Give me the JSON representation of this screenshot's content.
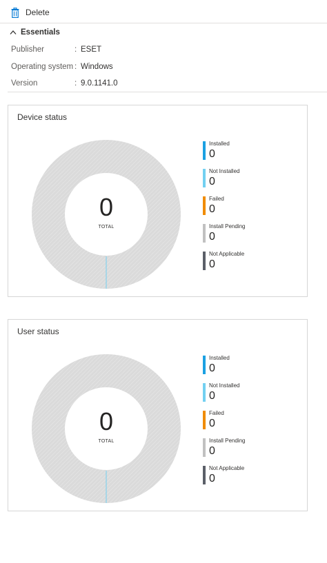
{
  "toolbar": {
    "delete_label": "Delete"
  },
  "essentials": {
    "header": "Essentials",
    "props": [
      {
        "key": "Publisher",
        "sep": ":",
        "value": "ESET"
      },
      {
        "key": "Operating system",
        "sep": ":",
        "value": "Windows"
      },
      {
        "key": "Version",
        "sep": ":",
        "value": "9.0.1141.0"
      }
    ]
  },
  "device_status": {
    "title": "Device status",
    "total": "0",
    "total_label": "TOTAL",
    "legend": [
      {
        "label": "Installed",
        "count": "0",
        "color": "#1ba1e2"
      },
      {
        "label": "Not Installed",
        "count": "0",
        "color": "#73d0f1"
      },
      {
        "label": "Failed",
        "count": "0",
        "color": "#f08c00"
      },
      {
        "label": "Install Pending",
        "count": "0",
        "color": "#c1c1c1"
      },
      {
        "label": "Not Applicable",
        "count": "0",
        "color": "#5b5f68"
      }
    ]
  },
  "user_status": {
    "title": "User status",
    "total": "0",
    "total_label": "TOTAL",
    "legend": [
      {
        "label": "Installed",
        "count": "0",
        "color": "#1ba1e2"
      },
      {
        "label": "Not Installed",
        "count": "0",
        "color": "#73d0f1"
      },
      {
        "label": "Failed",
        "count": "0",
        "color": "#f08c00"
      },
      {
        "label": "Install Pending",
        "count": "0",
        "color": "#c1c1c1"
      },
      {
        "label": "Not Applicable",
        "count": "0",
        "color": "#5b5f68"
      }
    ]
  },
  "colors": {
    "accent": "#0078d4",
    "donut_fill": "#d9d9d9",
    "donut_marker": "#73d0f1"
  }
}
